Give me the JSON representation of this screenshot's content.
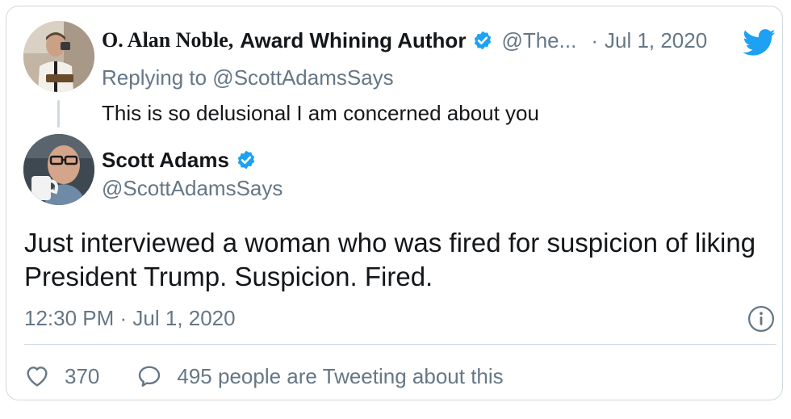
{
  "reply_tweet": {
    "author_name_part1": "O. Alan Noble,",
    "author_name_part2": "Award Whining Author",
    "handle": "@The...",
    "separator": "·",
    "date": "Jul 1, 2020",
    "replying_to": "Replying to @ScottAdamsSays",
    "text": "This is so delusional I am concerned about you",
    "avatar_icon": "author-photo-avatar",
    "verified_icon": "verified-badge-icon"
  },
  "main_tweet": {
    "author_name": "Scott Adams",
    "handle": "@ScottAdamsSays",
    "text": "Just interviewed a woman who was fired for suspicion of liking President Trump. Suspicion. Fired.",
    "timestamp": "12:30 PM · Jul 1, 2020",
    "likes": "370",
    "conversation": "495 people are Tweeting about this",
    "avatar_icon": "author-photo-avatar",
    "verified_icon": "verified-badge-icon"
  },
  "icons": {
    "brand": "twitter-bird-icon",
    "info": "info-icon",
    "like": "heart-icon",
    "reply": "speech-bubble-icon"
  },
  "colors": {
    "brand_blue": "#1da1f2",
    "secondary_text": "#657786",
    "primary_text": "#14171a",
    "border": "#cfd9de"
  }
}
